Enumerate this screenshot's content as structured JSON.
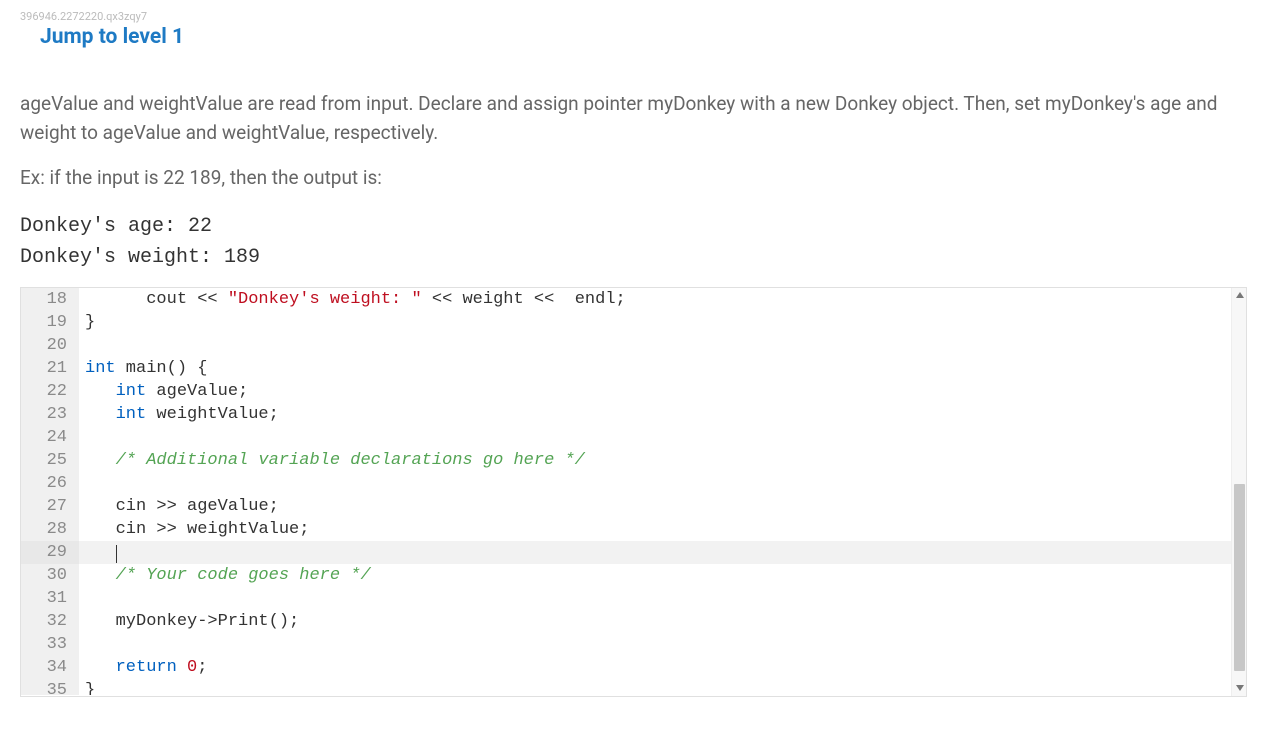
{
  "meta_id": "396946.2272220.qx3zqy7",
  "jump_link": "Jump to level 1",
  "instructions": "ageValue and weightValue are read from input. Declare and assign pointer myDonkey with a new Donkey object. Then, set myDonkey's age and weight to ageValue and weightValue, respectively.",
  "example_label": "Ex: if the input is 22 189, then the output is:",
  "example_output": "Donkey's age: 22\nDonkey's weight: 189",
  "editor": {
    "active_line": 29,
    "first_visible_line": 18,
    "lines": [
      {
        "n": 18,
        "tokens": [
          {
            "t": "      cout ",
            "c": "plain"
          },
          {
            "t": "<<",
            "c": "plain"
          },
          {
            "t": " ",
            "c": "plain"
          },
          {
            "t": "\"Donkey's weight: \"",
            "c": "string"
          },
          {
            "t": " ",
            "c": "plain"
          },
          {
            "t": "<<",
            "c": "plain"
          },
          {
            "t": " weight ",
            "c": "plain"
          },
          {
            "t": "<<",
            "c": "plain"
          },
          {
            "t": "  endl;",
            "c": "plain"
          }
        ]
      },
      {
        "n": 19,
        "tokens": [
          {
            "t": "}",
            "c": "plain"
          }
        ]
      },
      {
        "n": 20,
        "tokens": []
      },
      {
        "n": 21,
        "tokens": [
          {
            "t": "int",
            "c": "keyword"
          },
          {
            "t": " main() {",
            "c": "plain"
          }
        ]
      },
      {
        "n": 22,
        "tokens": [
          {
            "t": "   ",
            "c": "plain"
          },
          {
            "t": "int",
            "c": "keyword"
          },
          {
            "t": " ageValue;",
            "c": "plain"
          }
        ]
      },
      {
        "n": 23,
        "tokens": [
          {
            "t": "   ",
            "c": "plain"
          },
          {
            "t": "int",
            "c": "keyword"
          },
          {
            "t": " weightValue;",
            "c": "plain"
          }
        ]
      },
      {
        "n": 24,
        "tokens": []
      },
      {
        "n": 25,
        "tokens": [
          {
            "t": "   ",
            "c": "plain"
          },
          {
            "t": "/* Additional variable declarations go here */",
            "c": "comment"
          }
        ]
      },
      {
        "n": 26,
        "tokens": []
      },
      {
        "n": 27,
        "tokens": [
          {
            "t": "   cin ",
            "c": "plain"
          },
          {
            "t": ">>",
            "c": "plain"
          },
          {
            "t": " ageValue;",
            "c": "plain"
          }
        ]
      },
      {
        "n": 28,
        "tokens": [
          {
            "t": "   cin ",
            "c": "plain"
          },
          {
            "t": ">>",
            "c": "plain"
          },
          {
            "t": " weightValue;",
            "c": "plain"
          }
        ]
      },
      {
        "n": 29,
        "tokens": [
          {
            "t": "   ",
            "c": "plain"
          }
        ],
        "cursor": true
      },
      {
        "n": 30,
        "tokens": [
          {
            "t": "   ",
            "c": "plain"
          },
          {
            "t": "/* Your code goes here */",
            "c": "comment"
          }
        ]
      },
      {
        "n": 31,
        "tokens": []
      },
      {
        "n": 32,
        "tokens": [
          {
            "t": "   myDonkey->Print();",
            "c": "plain"
          }
        ]
      },
      {
        "n": 33,
        "tokens": []
      },
      {
        "n": 34,
        "tokens": [
          {
            "t": "   ",
            "c": "plain"
          },
          {
            "t": "return",
            "c": "keyword"
          },
          {
            "t": " ",
            "c": "plain"
          },
          {
            "t": "0",
            "c": "number"
          },
          {
            "t": ";",
            "c": "plain"
          }
        ]
      },
      {
        "n": 35,
        "tokens": [
          {
            "t": "}",
            "c": "plain"
          }
        ],
        "cut": true
      }
    ]
  },
  "scrollbar": {
    "thumb_top_pct": 48,
    "thumb_height_pct": 46
  }
}
